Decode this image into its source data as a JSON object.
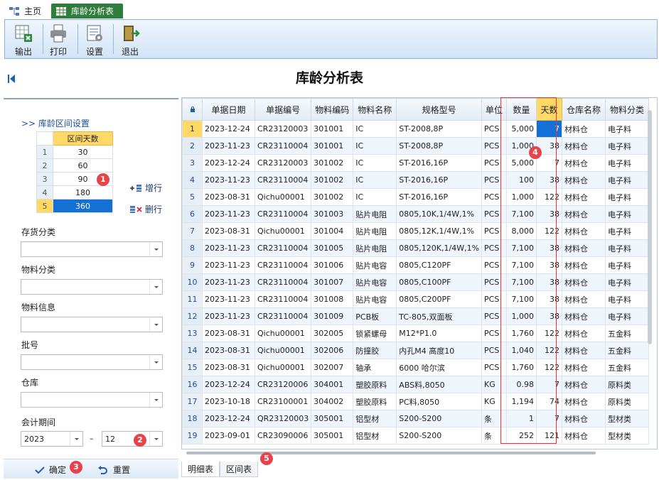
{
  "tabs": {
    "home": "主页",
    "report": "库龄分析表"
  },
  "toolbar": {
    "export": "输出",
    "print": "打印",
    "settings": "设置",
    "exit": "退出"
  },
  "title": "库龄分析表",
  "left": {
    "interval_header": ">> 库龄区间设置",
    "interval_col": "区间天数",
    "intervals": [
      {
        "idx": "1",
        "val": "30"
      },
      {
        "idx": "2",
        "val": "60"
      },
      {
        "idx": "3",
        "val": "90"
      },
      {
        "idx": "4",
        "val": "180"
      },
      {
        "idx": "5",
        "val": "360"
      }
    ],
    "add_row": "增行",
    "del_row": "删行",
    "stock_cat": "存货分类",
    "material_cat": "物料分类",
    "material_info": "物料信息",
    "batch": "批号",
    "warehouse": "仓库",
    "period": "会计期间",
    "year": "2023",
    "dash": "–",
    "month": "12",
    "confirm": "确定",
    "reset": "重置"
  },
  "badges": [
    "1",
    "2",
    "3",
    "4",
    "5"
  ],
  "grid": {
    "headers": [
      "单据日期",
      "单据编号",
      "物料编码",
      "物料名称",
      "规格型号",
      "单位",
      "数量",
      "天数",
      "仓库名称",
      "物料分类"
    ],
    "rows": [
      [
        "1",
        "2023-12-24",
        "CR23120003",
        "301001",
        "IC",
        "ST-2008,8P",
        "PCS",
        "5,000",
        "7",
        "材料仓",
        "电子料"
      ],
      [
        "2",
        "2023-11-23",
        "CR23110004",
        "301001",
        "IC",
        "ST-2008,8P",
        "PCS",
        "1,000",
        "38",
        "材料仓",
        "电子料"
      ],
      [
        "3",
        "2023-12-24",
        "CR23120003",
        "301002",
        "IC",
        "ST-2016,16P",
        "PCS",
        "5,000",
        "7",
        "材料仓",
        "电子料"
      ],
      [
        "4",
        "2023-11-23",
        "CR23110004",
        "301002",
        "IC",
        "ST-2016,16P",
        "PCS",
        "100",
        "38",
        "材料仓",
        "电子料"
      ],
      [
        "5",
        "2023-08-31",
        "Qichu00001",
        "301002",
        "IC",
        "ST-2016,16P",
        "PCS",
        "1,000",
        "122",
        "材料仓",
        "电子料"
      ],
      [
        "6",
        "2023-11-23",
        "CR23110004",
        "301003",
        "贴片电阻",
        "0805,10K,1/4W,1%",
        "PCS",
        "7,100",
        "38",
        "材料仓",
        "电子料"
      ],
      [
        "7",
        "2023-08-31",
        "Qichu00001",
        "301004",
        "贴片电阻",
        "0805,12K,1/4W,1%",
        "PCS",
        "8,000",
        "122",
        "材料仓",
        "电子料"
      ],
      [
        "8",
        "2023-11-23",
        "CR23110004",
        "301005",
        "贴片电阻",
        "0805,120K,1/4W,1%",
        "PCS",
        "7,100",
        "38",
        "材料仓",
        "电子料"
      ],
      [
        "9",
        "2023-11-23",
        "CR23110004",
        "301006",
        "贴片电容",
        "0805,C120PF",
        "PCS",
        "7,100",
        "38",
        "材料仓",
        "电子料"
      ],
      [
        "10",
        "2023-11-23",
        "CR23110004",
        "301007",
        "贴片电容",
        "0805,C100PF",
        "PCS",
        "7,100",
        "38",
        "材料仓",
        "电子料"
      ],
      [
        "11",
        "2023-11-23",
        "CR23110004",
        "301008",
        "贴片电容",
        "0805,C200PF",
        "PCS",
        "7,100",
        "38",
        "材料仓",
        "电子料"
      ],
      [
        "12",
        "2023-11-23",
        "CR23110004",
        "301009",
        "PCB板",
        "TC-805,双面板",
        "PCS",
        "1,000",
        "38",
        "材料仓",
        "电子料"
      ],
      [
        "13",
        "2023-08-31",
        "Qichu00001",
        "302005",
        "锁紧螺母",
        "M12*P1.0",
        "PCS",
        "1,760",
        "122",
        "材料仓",
        "五金料"
      ],
      [
        "14",
        "2023-08-31",
        "Qichu00001",
        "302006",
        "防撞胶",
        "内孔M4 高度10",
        "PCS",
        "1,040",
        "122",
        "材料仓",
        "五金料"
      ],
      [
        "15",
        "2023-08-31",
        "Qichu00001",
        "302007",
        "轴承",
        "6000 哈尔滨",
        "PCS",
        "1,760",
        "122",
        "材料仓",
        "五金料"
      ],
      [
        "16",
        "2023-12-24",
        "CR23120006",
        "304001",
        "塑胶原料",
        "ABS料,8050",
        "KG",
        "0.98",
        "7",
        "材料仓",
        "原料类"
      ],
      [
        "17",
        "2023-10-18",
        "CR23100001",
        "304002",
        "塑胶原料",
        "PC料,8050",
        "KG",
        "1,194",
        "74",
        "材料仓",
        "原料类"
      ],
      [
        "18",
        "2023-12-24",
        "QR23120003",
        "305001",
        "铝型材",
        "S200-S200",
        "条",
        "1",
        "7",
        "材料仓",
        "型材类"
      ],
      [
        "19",
        "2023-09-01",
        "CR23090006",
        "305001",
        "铝型材",
        "S200-S200",
        "条",
        "252",
        "121",
        "材料仓",
        "型材类"
      ]
    ]
  },
  "bottom_tabs": [
    "明细表",
    "区间表"
  ],
  "colors": {
    "accent": "#1370d6",
    "highlight": "#ffd866",
    "tab_green": "#2f7d3a",
    "badge_red": "#e8424a"
  }
}
